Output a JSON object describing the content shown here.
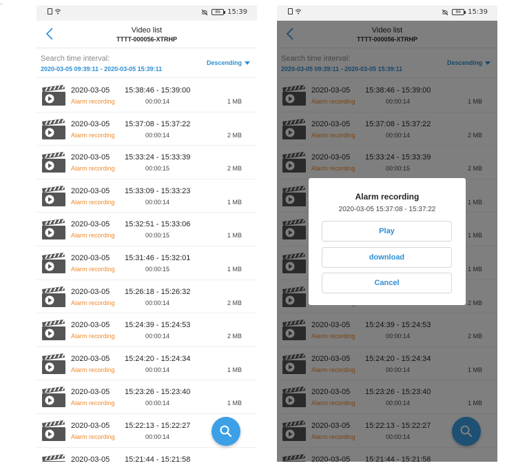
{
  "status_bar": {
    "time": "15:39",
    "battery": "86"
  },
  "header": {
    "title": "Video list",
    "subtitle": "TTTT-000056-XTRHP"
  },
  "filter": {
    "label": "Search time interval:",
    "range": "2020-03-05 09:39:11 - 2020-03-05 15:39:11",
    "sort": "Descending"
  },
  "videos": [
    {
      "date": "2020-03-05",
      "time": "15:38:46 - 15:39:00",
      "type": "Alarm recording",
      "duration": "00:00:14",
      "size": "1 MB"
    },
    {
      "date": "2020-03-05",
      "time": "15:37:08 - 15:37:22",
      "type": "Alarm recording",
      "duration": "00:00:14",
      "size": "2 MB"
    },
    {
      "date": "2020-03-05",
      "time": "15:33:24 - 15:33:39",
      "type": "Alarm recording",
      "duration": "00:00:15",
      "size": "2 MB"
    },
    {
      "date": "2020-03-05",
      "time": "15:33:09 - 15:33:23",
      "type": "Alarm recording",
      "duration": "00:00:14",
      "size": "1 MB"
    },
    {
      "date": "2020-03-05",
      "time": "15:32:51 - 15:33:06",
      "type": "Alarm recording",
      "duration": "00:00:15",
      "size": "1 MB"
    },
    {
      "date": "2020-03-05",
      "time": "15:31:46 - 15:32:01",
      "type": "Alarm recording",
      "duration": "00:00:15",
      "size": "1 MB"
    },
    {
      "date": "2020-03-05",
      "time": "15:26:18 - 15:26:32",
      "type": "Alarm recording",
      "duration": "00:00:14",
      "size": "2 MB"
    },
    {
      "date": "2020-03-05",
      "time": "15:24:39 - 15:24:53",
      "type": "Alarm recording",
      "duration": "00:00:14",
      "size": "2 MB"
    },
    {
      "date": "2020-03-05",
      "time": "15:24:20 - 15:24:34",
      "type": "Alarm recording",
      "duration": "00:00:14",
      "size": "1 MB"
    },
    {
      "date": "2020-03-05",
      "time": "15:23:26 - 15:23:40",
      "type": "Alarm recording",
      "duration": "00:00:14",
      "size": "1 MB"
    },
    {
      "date": "2020-03-05",
      "time": "15:22:13 - 15:22:27",
      "type": "Alarm recording",
      "duration": "00:00:14",
      "size": ""
    },
    {
      "date": "2020-03-05",
      "time": "15:21:44 - 15:21:58",
      "type": "",
      "duration": "",
      "size": ""
    }
  ],
  "dialog": {
    "title": "Alarm recording",
    "subtitle": "2020-03-05   15:37:08 - 15:37:22",
    "play_label": "Play",
    "download_label": "download",
    "cancel_label": "Cancel"
  },
  "colors": {
    "accent": "#2e8ed3",
    "alarm": "#f08a2c",
    "fab": "#3ba0e6"
  }
}
